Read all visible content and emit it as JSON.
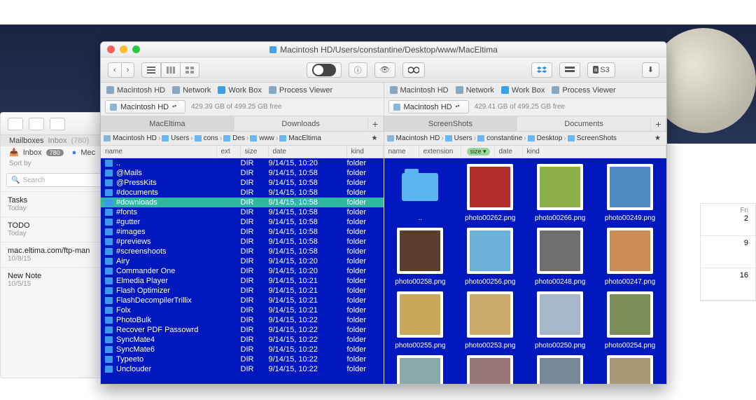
{
  "window_title": "Macintosh HD/Users/constantine/Desktop/www/MacEltima",
  "toolbar": {
    "nav_back": "‹",
    "nav_fwd": "›",
    "s3_label": "S3"
  },
  "locations": {
    "items": [
      "Macintosh HD",
      "Network",
      "Work Box",
      "Process Viewer"
    ]
  },
  "left": {
    "volume": "Macintosh HD",
    "free": "429.39 GB of 499.25 GB free",
    "tab_active": "MacEltima",
    "tab_other": "Downloads",
    "crumbs": [
      "Macintosh HD",
      "Users",
      "cons",
      "Des",
      "www",
      "MacEltima"
    ],
    "col": {
      "name": "name",
      "ext": "ext",
      "size": "size",
      "date": "date",
      "kind": "kind"
    },
    "rows": [
      {
        "name": "..",
        "size": "DIR",
        "date": "9/14/15, 10:20",
        "kind": "folder"
      },
      {
        "name": "@Mails",
        "size": "DIR",
        "date": "9/14/15, 10:58",
        "kind": "folder"
      },
      {
        "name": "@PressKits",
        "size": "DIR",
        "date": "9/14/15, 10:58",
        "kind": "folder"
      },
      {
        "name": "#documents",
        "size": "DIR",
        "date": "9/14/15, 10:58",
        "kind": "folder"
      },
      {
        "name": "#downloads",
        "size": "DIR",
        "date": "9/14/15, 10:58",
        "kind": "folder",
        "selected": true
      },
      {
        "name": "#fonts",
        "size": "DIR",
        "date": "9/14/15, 10:58",
        "kind": "folder"
      },
      {
        "name": "#gutter",
        "size": "DIR",
        "date": "9/14/15, 10:58",
        "kind": "folder"
      },
      {
        "name": "#images",
        "size": "DIR",
        "date": "9/14/15, 10:58",
        "kind": "folder"
      },
      {
        "name": "#previews",
        "size": "DIR",
        "date": "9/14/15, 10:58",
        "kind": "folder"
      },
      {
        "name": "#screenshoots",
        "size": "DIR",
        "date": "9/14/15, 10:58",
        "kind": "folder"
      },
      {
        "name": "Airy",
        "size": "DIR",
        "date": "9/14/15, 10:20",
        "kind": "folder"
      },
      {
        "name": "Commander One",
        "size": "DIR",
        "date": "9/14/15, 10:20",
        "kind": "folder"
      },
      {
        "name": "Elmedia Player",
        "size": "DIR",
        "date": "9/14/15, 10:21",
        "kind": "folder"
      },
      {
        "name": "Flash Optimizer",
        "size": "DIR",
        "date": "9/14/15, 10:21",
        "kind": "folder"
      },
      {
        "name": "FlashDecompilerTrillix",
        "size": "DIR",
        "date": "9/14/15, 10:21",
        "kind": "folder"
      },
      {
        "name": "Folx",
        "size": "DIR",
        "date": "9/14/15, 10:21",
        "kind": "folder"
      },
      {
        "name": "PhotoBulk",
        "size": "DIR",
        "date": "9/14/15, 10:22",
        "kind": "folder"
      },
      {
        "name": "Recover PDF Passowrd",
        "size": "DIR",
        "date": "9/14/15, 10:22",
        "kind": "folder"
      },
      {
        "name": "SyncMate4",
        "size": "DIR",
        "date": "9/14/15, 10:22",
        "kind": "folder"
      },
      {
        "name": "SyncMate6",
        "size": "DIR",
        "date": "9/14/15, 10:22",
        "kind": "folder"
      },
      {
        "name": "Typeeto",
        "size": "DIR",
        "date": "9/14/15, 10:22",
        "kind": "folder"
      },
      {
        "name": "Unclouder",
        "size": "DIR",
        "date": "9/14/15, 10:22",
        "kind": "folder"
      }
    ]
  },
  "right": {
    "volume": "Macintosh HD",
    "free": "429.41 GB of 499.25 GB free",
    "tab_active": "ScreenShots",
    "tab_other": "Documents",
    "crumbs": [
      "Macintosh HD",
      "Users",
      "constantine",
      "Desktop",
      "ScreenShots"
    ],
    "col": {
      "name": "name",
      "ext": "extension",
      "sort": "size ▾",
      "date": "date",
      "kind": "kind"
    },
    "items": [
      {
        "name": ".."
      },
      {
        "name": "photo00262.png",
        "c": "#b42d2d"
      },
      {
        "name": "photo00266.png",
        "c": "#8db04a"
      },
      {
        "name": "photo00249.png",
        "c": "#4f89c1"
      },
      {
        "name": "photo00258.png",
        "c": "#5a3f2c"
      },
      {
        "name": "photo00256.png",
        "c": "#6ab0d8"
      },
      {
        "name": "photo00248.png",
        "c": "#6e6e6e"
      },
      {
        "name": "photo00247.png",
        "c": "#cc8d55"
      },
      {
        "name": "photo00255.png",
        "c": "#c9a85b"
      },
      {
        "name": "photo00253.png",
        "c": "#caa96a"
      },
      {
        "name": "photo00250.png",
        "c": "#a6b7ca"
      },
      {
        "name": "photo00254.png",
        "c": "#7c8f59"
      },
      {
        "name": "",
        "c": "#8aa"
      },
      {
        "name": "",
        "c": "#977"
      },
      {
        "name": "",
        "c": "#789"
      },
      {
        "name": "",
        "c": "#a97"
      }
    ]
  },
  "mail": {
    "mailboxes": "Mailboxes",
    "inbox": "Inbox",
    "inbox_badge": "(780)",
    "inbox_list": "Inbox",
    "badge": "780",
    "search": "Search",
    "sort": "Sort by",
    "unread": "Mec",
    "items": [
      {
        "t": "Tasks",
        "d": "Today"
      },
      {
        "t": "TODO",
        "d": "Today"
      },
      {
        "t": "mac.eltima.com/ftp-man",
        "d": "10/8/15"
      },
      {
        "t": "New Note",
        "d": "10/5/15"
      }
    ]
  },
  "cal": {
    "hd": "Fri",
    "d1": "2",
    "d2": "9",
    "d3": "16"
  }
}
